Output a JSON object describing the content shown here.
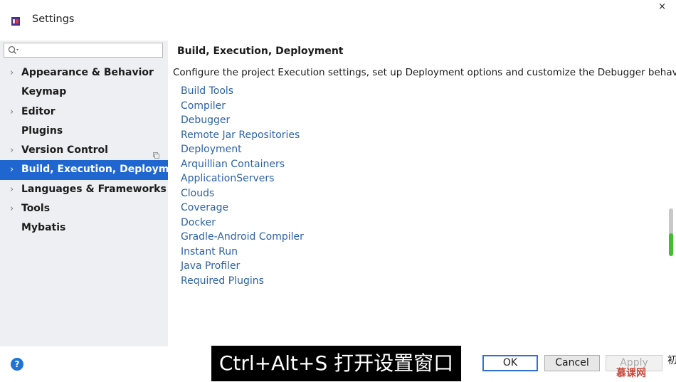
{
  "window": {
    "title": "Settings",
    "close_glyph": "×"
  },
  "search": {
    "placeholder": "",
    "value": ""
  },
  "sidebar": {
    "items": [
      {
        "label": "Appearance & Behavior",
        "expandable": true
      },
      {
        "label": "Keymap",
        "expandable": false
      },
      {
        "label": "Editor",
        "expandable": true
      },
      {
        "label": "Plugins",
        "expandable": false
      },
      {
        "label": "Version Control",
        "expandable": true
      },
      {
        "label": "Build, Execution, Deploymen",
        "expandable": true,
        "selected": true
      },
      {
        "label": "Languages & Frameworks",
        "expandable": true
      },
      {
        "label": "Tools",
        "expandable": true
      },
      {
        "label": "Mybatis",
        "expandable": false
      }
    ]
  },
  "main": {
    "heading": "Build, Execution, Deployment",
    "description": "Configure the project Execution settings, set up Deployment options and customize the Debugger behavior.",
    "links": [
      "Build Tools",
      "Compiler",
      "Debugger",
      "Remote Jar Repositories",
      "Deployment",
      "Arquillian Containers",
      "ApplicationServers",
      "Clouds",
      "Coverage",
      "Docker",
      "Gradle-Android Compiler",
      "Instant Run",
      "Java Profiler",
      "Required Plugins"
    ]
  },
  "footer": {
    "help": "?",
    "ok": "OK",
    "cancel": "Cancel",
    "apply": "Apply",
    "edge_char": "初"
  },
  "overlay": {
    "subtitle": "Ctrl+Alt+S 打开设置窗口",
    "brand": "慕课网"
  },
  "colors": {
    "selection": "#1f66d1",
    "link": "#2d62a6",
    "accent_green": "#3fbf2a"
  }
}
